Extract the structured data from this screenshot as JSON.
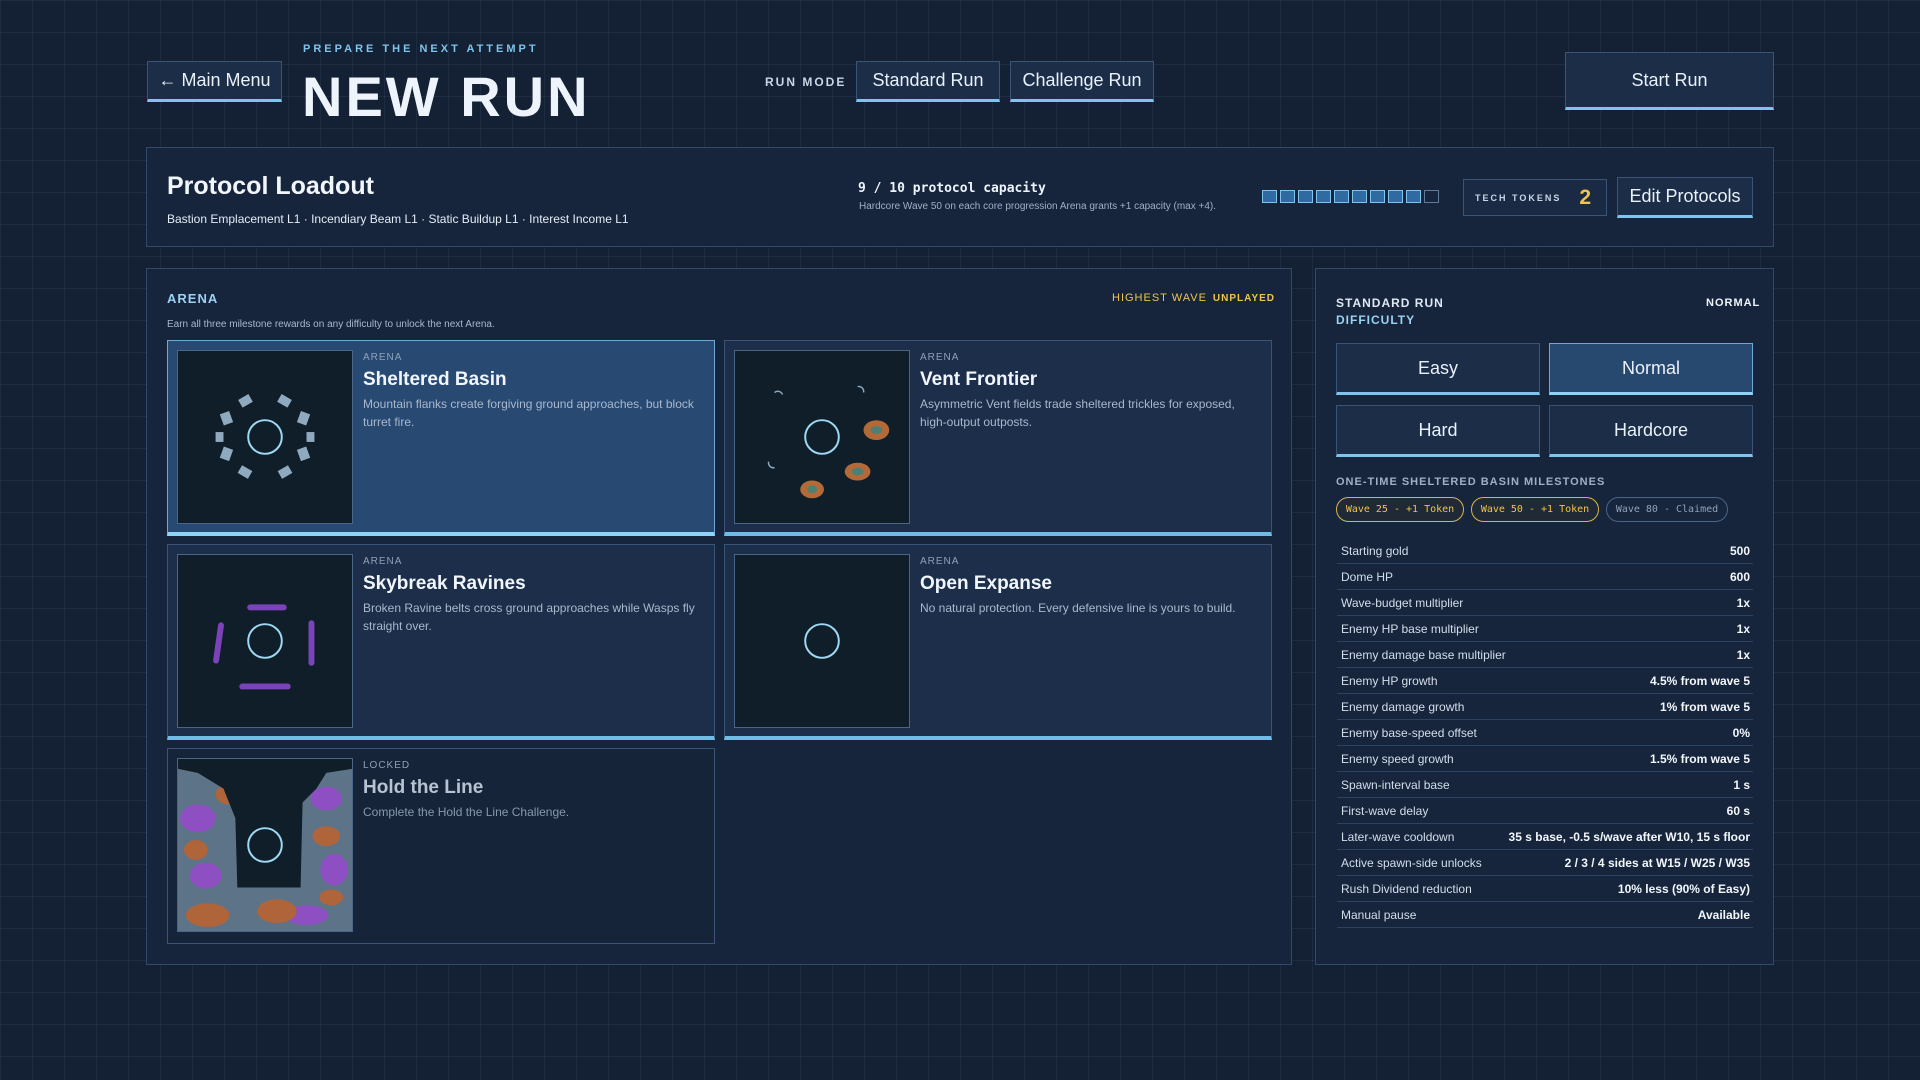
{
  "header": {
    "back_label": "← Main Menu",
    "kicker": "PREPARE THE NEXT ATTEMPT",
    "title": "NEW RUN",
    "run_mode_label": "RUN MODE",
    "run_modes": [
      "Standard Run",
      "Challenge Run"
    ],
    "start_label": "Start Run"
  },
  "loadout": {
    "title": "Protocol Loadout",
    "protocols": "Bastion Emplacement L1 · Incendiary Beam L1 · Static Buildup L1 · Interest Income L1",
    "capacity_text": "9 / 10 protocol capacity",
    "capacity_used": 9,
    "capacity_max": 10,
    "capacity_note": "Hardcore Wave 50 on each core progression Arena grants +1 capacity (max +4).",
    "tokens_label": "TECH TOKENS",
    "tokens_value": "2",
    "edit_label": "Edit Protocols"
  },
  "arena": {
    "header": "ARENA",
    "subtitle": "Earn all three milestone rewards on any difficulty to unlock the next Arena.",
    "highest_wave_label": "HIGHEST WAVE",
    "highest_wave_value": "UNPLAYED",
    "cards": [
      {
        "kind": "ARENA",
        "name": "Sheltered Basin",
        "desc": "Mountain flanks create forgiving ground approaches, but block turret fire."
      },
      {
        "kind": "ARENA",
        "name": "Vent Frontier",
        "desc": "Asymmetric Vent fields trade sheltered trickles for exposed, high-output outposts."
      },
      {
        "kind": "ARENA",
        "name": "Skybreak Ravines",
        "desc": "Broken Ravine belts cross ground approaches while Wasps fly straight over."
      },
      {
        "kind": "ARENA",
        "name": "Open Expanse",
        "desc": "No natural protection. Every defensive line is yours to build."
      },
      {
        "kind": "LOCKED",
        "name": "Hold the Line",
        "desc": "Complete the Hold the Line Challenge."
      }
    ]
  },
  "side": {
    "title_line1": "STANDARD RUN",
    "title_line2": "DIFFICULTY",
    "current_difficulty": "NORMAL",
    "difficulties": [
      "Easy",
      "Normal",
      "Hard",
      "Hardcore"
    ],
    "milestones_header": "ONE-TIME SHELTERED BASIN MILESTONES",
    "milestones": [
      "Wave 25 - +1 Token",
      "Wave 50 - +1 Token",
      "Wave 80 - Claimed"
    ],
    "stats": [
      {
        "k": "Starting gold",
        "v": "500"
      },
      {
        "k": "Dome HP",
        "v": "600"
      },
      {
        "k": "Wave-budget multiplier",
        "v": "1x"
      },
      {
        "k": "Enemy HP base multiplier",
        "v": "1x"
      },
      {
        "k": "Enemy damage base multiplier",
        "v": "1x"
      },
      {
        "k": "Enemy HP growth",
        "v": "4.5% from wave 5"
      },
      {
        "k": "Enemy damage growth",
        "v": "1% from wave 5"
      },
      {
        "k": "Enemy base-speed offset",
        "v": "0%"
      },
      {
        "k": "Enemy speed growth",
        "v": "1.5% from wave 5"
      },
      {
        "k": "Spawn-interval base",
        "v": "1 s"
      },
      {
        "k": "First-wave delay",
        "v": "60 s"
      },
      {
        "k": "Later-wave cooldown",
        "v": "35 s base, -0.5 s/wave after W10, 15 s floor"
      },
      {
        "k": "Active spawn-side unlocks",
        "v": "2 / 3 / 4 sides at W15 / W25 / W35"
      },
      {
        "k": "Rush Dividend reduction",
        "v": "10% less (90% of Easy)"
      },
      {
        "k": "Manual pause",
        "v": "Available"
      }
    ]
  },
  "colors": {
    "accent": "#7fc4ec",
    "gold": "#f0c44a",
    "panel": "#16253c",
    "background": "#142033"
  }
}
